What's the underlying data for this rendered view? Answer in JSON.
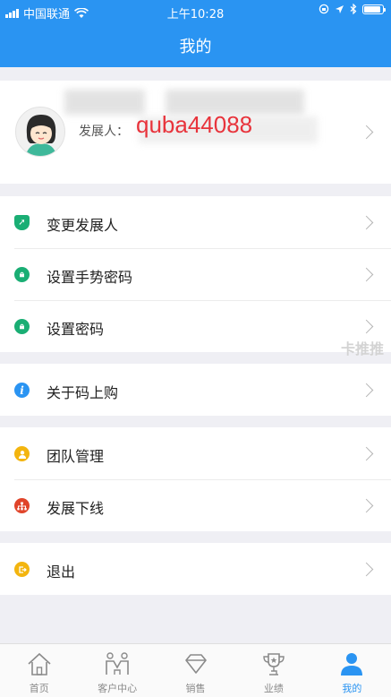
{
  "status_bar": {
    "carrier": "中国联通",
    "time": "上午10:28"
  },
  "nav": {
    "title": "我的"
  },
  "profile": {
    "developer_label": "发展人：",
    "developer_value": "quba44088"
  },
  "menu_groups": [
    {
      "items": [
        {
          "label": "变更发展人",
          "icon": "shield-share-icon",
          "color": "#1aae74"
        },
        {
          "label": "设置手势密码",
          "icon": "lock-icon",
          "color": "#1aae74"
        },
        {
          "label": "设置密码",
          "icon": "lock-icon",
          "color": "#1aae74"
        }
      ]
    },
    {
      "items": [
        {
          "label": "关于码上购",
          "icon": "info-icon",
          "color": "#2a94f2"
        }
      ]
    },
    {
      "items": [
        {
          "label": "团队管理",
          "icon": "team-icon",
          "color": "#f3b50f"
        },
        {
          "label": "发展下线",
          "icon": "org-chart-icon",
          "color": "#e0442a"
        }
      ]
    },
    {
      "items": [
        {
          "label": "退出",
          "icon": "exit-icon",
          "color": "#f3b50f"
        }
      ]
    }
  ],
  "watermark": "卡推推",
  "tabbar": {
    "tabs": [
      {
        "label": "首页",
        "icon": "home-icon"
      },
      {
        "label": "客户中心",
        "icon": "customer-center-icon"
      },
      {
        "label": "销售",
        "icon": "diamond-icon"
      },
      {
        "label": "业绩",
        "icon": "trophy-icon"
      },
      {
        "label": "我的",
        "icon": "person-icon",
        "active": true
      }
    ],
    "active_color": "#2a94f2"
  }
}
